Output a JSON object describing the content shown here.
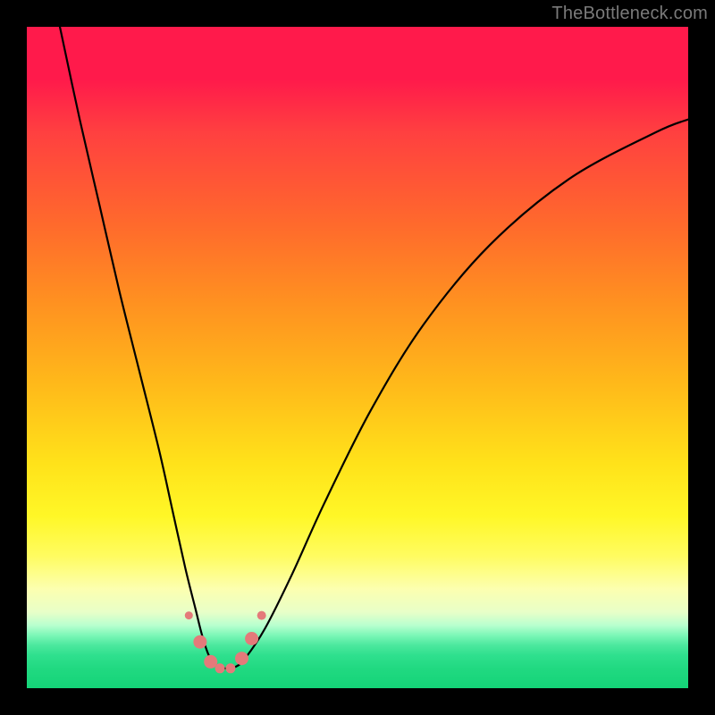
{
  "watermark": "TheBottleneck.com",
  "chart_data": {
    "type": "line",
    "title": "",
    "xlabel": "",
    "ylabel": "",
    "xlim": [
      0,
      100
    ],
    "ylim": [
      0,
      100
    ],
    "series": [
      {
        "name": "bottleneck-curve",
        "x": [
          5,
          8,
          11,
          14,
          17,
          20,
          22,
          24,
          25.5,
          26.5,
          27.5,
          28.5,
          30,
          31.5,
          33,
          36,
          40,
          45,
          52,
          60,
          70,
          82,
          95,
          100
        ],
        "y": [
          100,
          86,
          73,
          60,
          48,
          36,
          27,
          18,
          12,
          8,
          5,
          3.5,
          3,
          3.2,
          4.5,
          9,
          17,
          28,
          42,
          55,
          67,
          77,
          84,
          86
        ]
      }
    ],
    "markers": {
      "name": "highlight-dots",
      "color": "#e47a7a",
      "points": [
        {
          "x": 24.5,
          "y": 11,
          "r": 4.5
        },
        {
          "x": 26.2,
          "y": 7,
          "r": 7.5
        },
        {
          "x": 27.8,
          "y": 4,
          "r": 7.5
        },
        {
          "x": 29.2,
          "y": 3,
          "r": 5.5
        },
        {
          "x": 30.8,
          "y": 3,
          "r": 5.5
        },
        {
          "x": 32.5,
          "y": 4.5,
          "r": 7.5
        },
        {
          "x": 34.0,
          "y": 7.5,
          "r": 7.5
        },
        {
          "x": 35.5,
          "y": 11,
          "r": 5.0
        }
      ]
    },
    "background_gradient": {
      "top": "#ff1a4b",
      "mid": "#ffe21a",
      "bottom": "#14d478"
    }
  }
}
